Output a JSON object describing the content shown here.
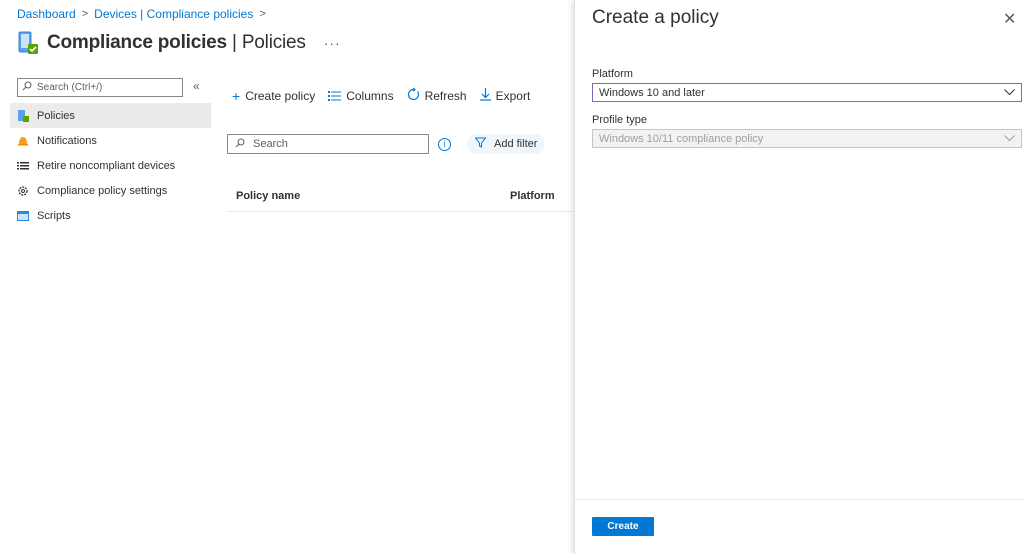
{
  "breadcrumb": {
    "items": [
      "Dashboard",
      "Devices | Compliance policies"
    ]
  },
  "header": {
    "title_bold": "Compliance policies",
    "title_sep": " | ",
    "title_light": "Policies",
    "more": "···"
  },
  "sidebar": {
    "search_placeholder": "Search (Ctrl+/)",
    "collapse": "«",
    "items": [
      {
        "label": "Policies",
        "icon": "policy-icon"
      },
      {
        "label": "Notifications",
        "icon": "bell-icon"
      },
      {
        "label": "Retire noncompliant devices",
        "icon": "list-icon"
      },
      {
        "label": "Compliance policy settings",
        "icon": "gear-icon"
      },
      {
        "label": "Scripts",
        "icon": "script-icon"
      }
    ]
  },
  "toolbar": {
    "create": "Create policy",
    "columns": "Columns",
    "refresh": "Refresh",
    "export": "Export"
  },
  "filter": {
    "search_placeholder": "Search",
    "add_filter": "Add filter"
  },
  "table": {
    "columns": [
      "Policy name",
      "Platform"
    ]
  },
  "panel": {
    "title": "Create a policy",
    "platform_label": "Platform",
    "platform_value": "Windows 10 and later",
    "profile_label": "Profile type",
    "profile_value": "Windows 10/11 compliance policy",
    "create_button": "Create"
  },
  "colors": {
    "accent": "#0078d4",
    "focus_border": "#8764b8"
  }
}
